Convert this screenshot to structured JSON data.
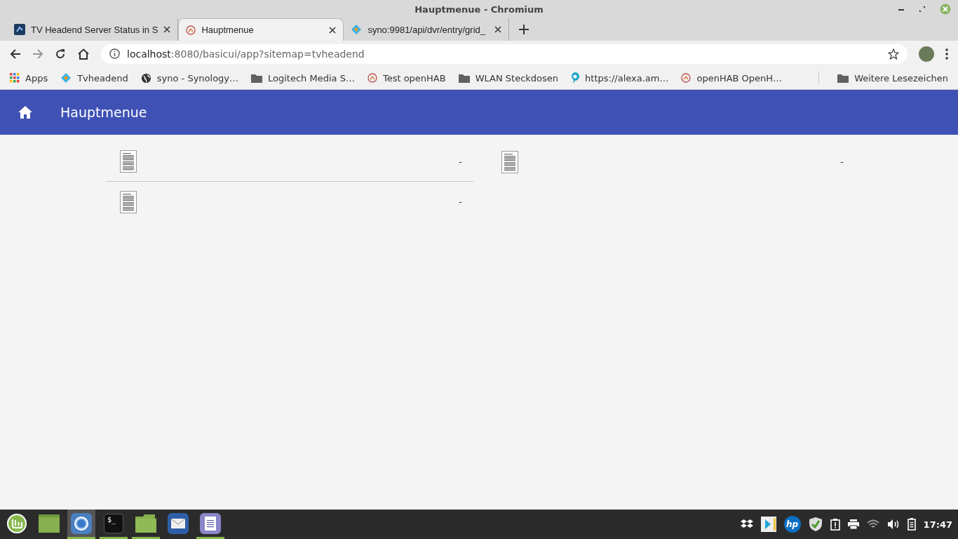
{
  "window": {
    "title": "Hauptmenue - Chromium"
  },
  "tabs": [
    {
      "title": "TV Headend Server Status in S",
      "selected": false
    },
    {
      "title": "Hauptmenue",
      "selected": true
    },
    {
      "title": "syno:9981/api/dvr/entry/grid_",
      "selected": false
    }
  ],
  "address_bar": {
    "host": "localhost",
    "path": ":8080/basicui/app?sitemap=tvheadend"
  },
  "bookmarks": [
    {
      "label": "Apps"
    },
    {
      "label": "Tvheadend"
    },
    {
      "label": "syno - Synology…"
    },
    {
      "label": "Logitech Media S…"
    },
    {
      "label": "Test openHAB"
    },
    {
      "label": "WLAN Steckdosen"
    },
    {
      "label": "https://alexa.am…"
    },
    {
      "label": "openHAB OpenH…"
    }
  ],
  "other_bookmarks": "Weitere Lesezeichen",
  "app_header": {
    "title": "Hauptmenue"
  },
  "widgets": [
    [
      {
        "value": "-"
      },
      {
        "value": "-"
      }
    ],
    [
      {
        "value": "-"
      }
    ]
  ],
  "taskbar": {
    "apps": [
      {
        "kind": "mint",
        "running": false,
        "selected": false
      },
      {
        "kind": "desktop",
        "running": false,
        "selected": false
      },
      {
        "kind": "chromium",
        "running": true,
        "selected": true
      },
      {
        "kind": "terminal",
        "glyph": "$_",
        "running": true,
        "selected": false
      },
      {
        "kind": "files",
        "running": true,
        "selected": false
      },
      {
        "kind": "mail",
        "running": false,
        "selected": false
      },
      {
        "kind": "editor",
        "running": true,
        "selected": false
      }
    ],
    "hp_label": "hp",
    "clock": "17:47"
  }
}
